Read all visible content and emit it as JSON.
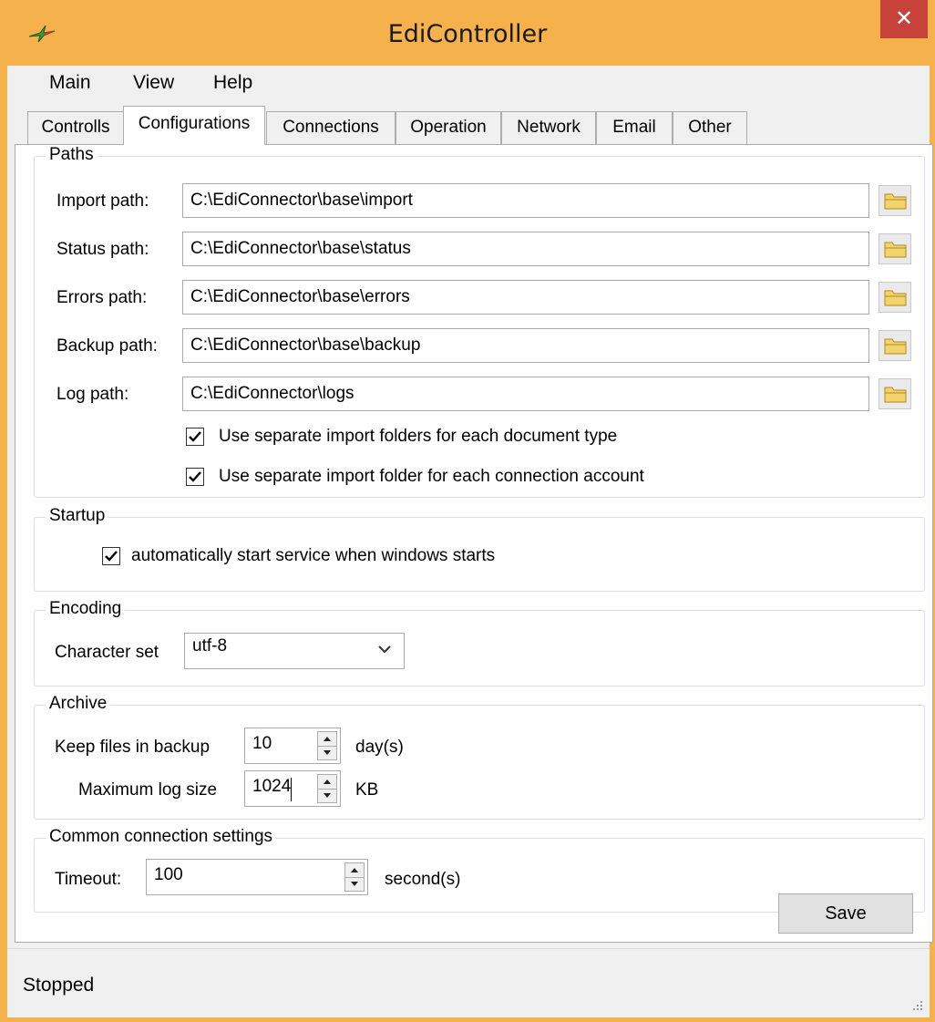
{
  "window": {
    "title": "EdiController",
    "close_label": "✕"
  },
  "menu": {
    "items": [
      "Main",
      "View",
      "Help"
    ]
  },
  "tabs": [
    "Controlls",
    "Configurations",
    "Connections",
    "Operation",
    "Network",
    "Email",
    "Other"
  ],
  "active_tab": "Configurations",
  "paths": {
    "legend": "Paths",
    "rows": [
      {
        "label": "Import path:",
        "value": "C:\\EdiConnector\\base\\import"
      },
      {
        "label": "Status path:",
        "value": "C:\\EdiConnector\\base\\status"
      },
      {
        "label": "Errors path:",
        "value": "C:\\EdiConnector\\base\\errors"
      },
      {
        "label": "Backup path:",
        "value": "C:\\EdiConnector\\base\\backup"
      },
      {
        "label": "Log path:",
        "value": "C:\\EdiConnector\\logs"
      }
    ],
    "separate_doc_type": {
      "label": "Use separate import folders for each document type",
      "checked": true
    },
    "separate_account": {
      "label": "Use separate import folder for each connection account",
      "checked": true
    }
  },
  "startup": {
    "legend": "Startup",
    "autostart": {
      "label": "automatically start service when windows starts",
      "checked": true
    }
  },
  "encoding": {
    "legend": "Encoding",
    "label": "Character set",
    "value": "utf-8"
  },
  "archive": {
    "legend": "Archive",
    "keep_label": "Keep files in backup",
    "keep_value": "10",
    "keep_unit": "day(s)",
    "log_label": "Maximum log size",
    "log_value": "1024",
    "log_unit": "KB"
  },
  "connection": {
    "legend": "Common connection settings",
    "timeout_label": "Timeout:",
    "timeout_value": "100",
    "timeout_unit": "second(s)"
  },
  "save_label": "Save",
  "status": "Stopped",
  "colors": {
    "titlebar": "#f5b14b",
    "close": "#c7423a",
    "folder": "#f3d36b"
  }
}
